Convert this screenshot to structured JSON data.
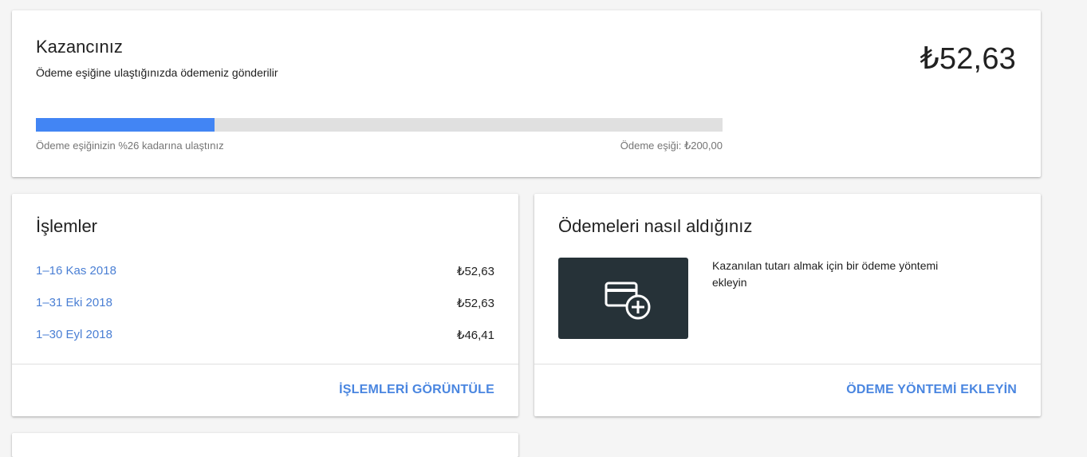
{
  "earnings": {
    "title": "Kazancınız",
    "subtitle": "Ödeme eşiğine ulaştığınızda ödemeniz gönderilir",
    "amount": "₺52,63",
    "progress_percent": 26,
    "progress_label": "Ödeme eşiğinizin %26 kadarına ulaştınız",
    "threshold_label": "Ödeme eşiği: ₺200,00"
  },
  "transactions": {
    "title": "İşlemler",
    "rows": [
      {
        "period": "1–16 Kas 2018",
        "amount": "₺52,63"
      },
      {
        "period": "1–31 Eki 2018",
        "amount": "₺52,63"
      },
      {
        "period": "1–30 Eyl 2018",
        "amount": "₺46,41"
      }
    ],
    "action_label": "İŞLEMLERİ GÖRÜNTÜLE"
  },
  "payments": {
    "title": "Ödemeleri nasıl aldığınız",
    "icon": "add-card-icon",
    "description": "Kazanılan tutarı almak için bir ödeme yöntemi ekleyin",
    "action_label": "ÖDEME YÖNTEMİ EKLEYİN"
  },
  "colors": {
    "accent": "#4285f4",
    "link": "#4a7fd4",
    "tile_bg": "#263238"
  }
}
